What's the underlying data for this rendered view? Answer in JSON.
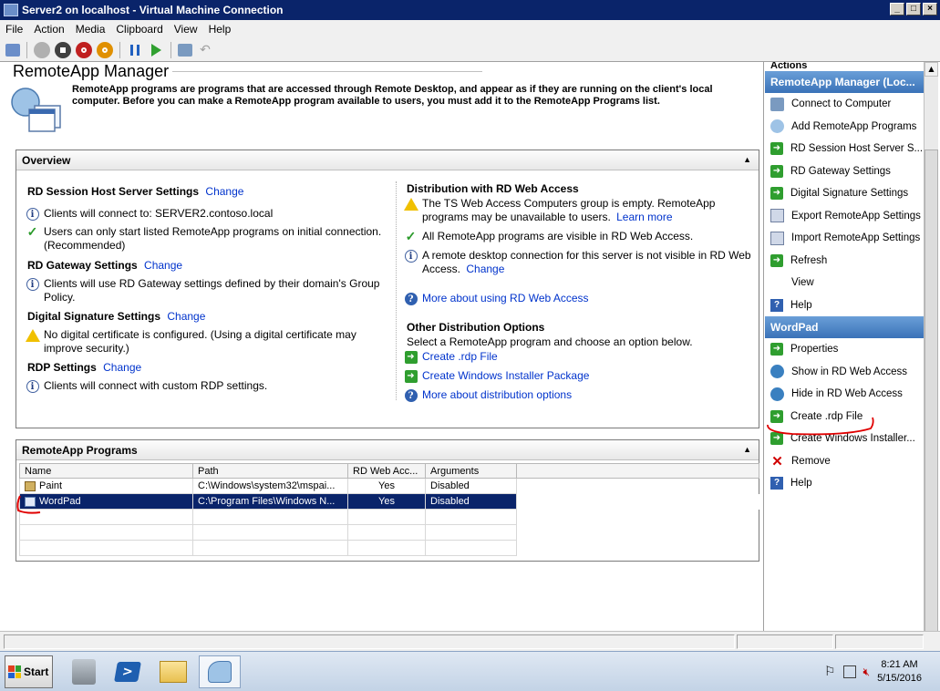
{
  "vm_window": {
    "title": "Server2 on localhost - Virtual Machine Connection",
    "menu": [
      "File",
      "Action",
      "Media",
      "Clipboard",
      "View",
      "Help"
    ]
  },
  "page": {
    "title": "RemoteApp Manager",
    "intro": "RemoteApp programs are programs that are accessed through Remote Desktop, and appear as if they are running on the client's local computer. Before you can make a RemoteApp program available to users, you must add it to the RemoteApp Programs list."
  },
  "overview": {
    "header": "Overview",
    "rdsh": {
      "title": "RD Session Host Server Settings",
      "change": "Change",
      "line1": "Clients will connect to: SERVER2.contoso.local",
      "line2": "Users can only start listed RemoteApp programs on initial connection. (Recommended)"
    },
    "gateway": {
      "title": "RD Gateway Settings",
      "change": "Change",
      "line1": "Clients will use RD Gateway settings defined by their domain's Group Policy."
    },
    "signature": {
      "title": "Digital Signature Settings",
      "change": "Change",
      "line1": "No digital certificate is configured. (Using a digital certificate may improve security.)"
    },
    "rdp": {
      "title": "RDP Settings",
      "change": "Change",
      "line1": "Clients will connect with custom RDP settings."
    },
    "webaccess": {
      "title": "Distribution with RD Web Access",
      "line1": "The TS Web Access Computers group is empty. RemoteApp programs may be unavailable to users.",
      "learn_more": "Learn more",
      "line2": "All RemoteApp programs are visible in RD Web Access.",
      "line3": "A remote desktop connection for this server is not visible in RD Web Access.",
      "change": "Change",
      "more": "More about using RD Web Access"
    },
    "other": {
      "title": "Other Distribution Options",
      "subtitle": "Select a RemoteApp program and choose an option below.",
      "create_rdp": "Create .rdp File",
      "create_msi": "Create Windows Installer Package",
      "more": "More about distribution options"
    }
  },
  "programs": {
    "header": "RemoteApp Programs",
    "columns": [
      "Name",
      "Path",
      "RD Web Acc...",
      "Arguments"
    ],
    "rows": [
      {
        "name": "Paint",
        "path": "C:\\Windows\\system32\\mspai...",
        "web": "Yes",
        "args": "Disabled"
      },
      {
        "name": "WordPad",
        "path": "C:\\Program Files\\Windows N...",
        "web": "Yes",
        "args": "Disabled"
      }
    ]
  },
  "actions": {
    "title": "Actions",
    "group1": "RemoteApp Manager (Loc...",
    "items1": [
      "Connect to Computer",
      "Add RemoteApp Programs",
      "RD Session Host Server S...",
      "RD Gateway Settings",
      "Digital Signature Settings",
      "Export RemoteApp Settings",
      "Import RemoteApp Settings",
      "Refresh",
      "View",
      "Help"
    ],
    "group2": "WordPad",
    "items2": [
      "Properties",
      "Show in RD Web Access",
      "Hide in RD Web Access",
      "Create .rdp File",
      "Create Windows Installer...",
      "Remove",
      "Help"
    ]
  },
  "taskbar": {
    "start": "Start",
    "time": "8:21 AM",
    "date": "5/15/2016"
  },
  "colors": {
    "title_bar": "#0a246a",
    "selection": "#0a246a",
    "link": "#0033cc",
    "action_group": "#3a72b8",
    "annotation": "#e00000"
  }
}
